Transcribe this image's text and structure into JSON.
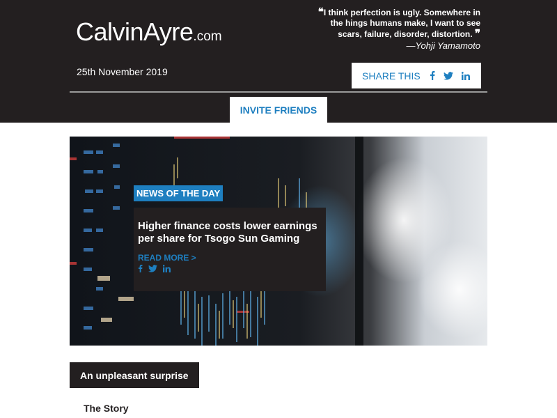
{
  "header": {
    "logo_main": "CalvinAyre",
    "logo_suffix": ".com",
    "quote_text": "I think perfection is ugly. Somewhere in the hings humans make, I want to see scars, failure, disorder, distortion.",
    "quote_author": "—Yohji Yamamoto",
    "date": "25th November 2019",
    "share_label": "SHARE THIS",
    "invite_label": "INVITE FRIENDS"
  },
  "hero": {
    "badge": "NEWS OF THE DAY",
    "title": "Higher finance costs lower earnings per share for Tsogo Sun Gaming",
    "read_more": "READ MORE >"
  },
  "section": {
    "tab_label": "An unpleasant surprise",
    "story_label": "The Story"
  },
  "icons": {
    "facebook": "facebook-icon",
    "twitter": "twitter-icon",
    "linkedin": "linkedin-icon"
  },
  "colors": {
    "dark": "#231f20",
    "accent": "#1e7fc0",
    "background": "#ffffff"
  }
}
